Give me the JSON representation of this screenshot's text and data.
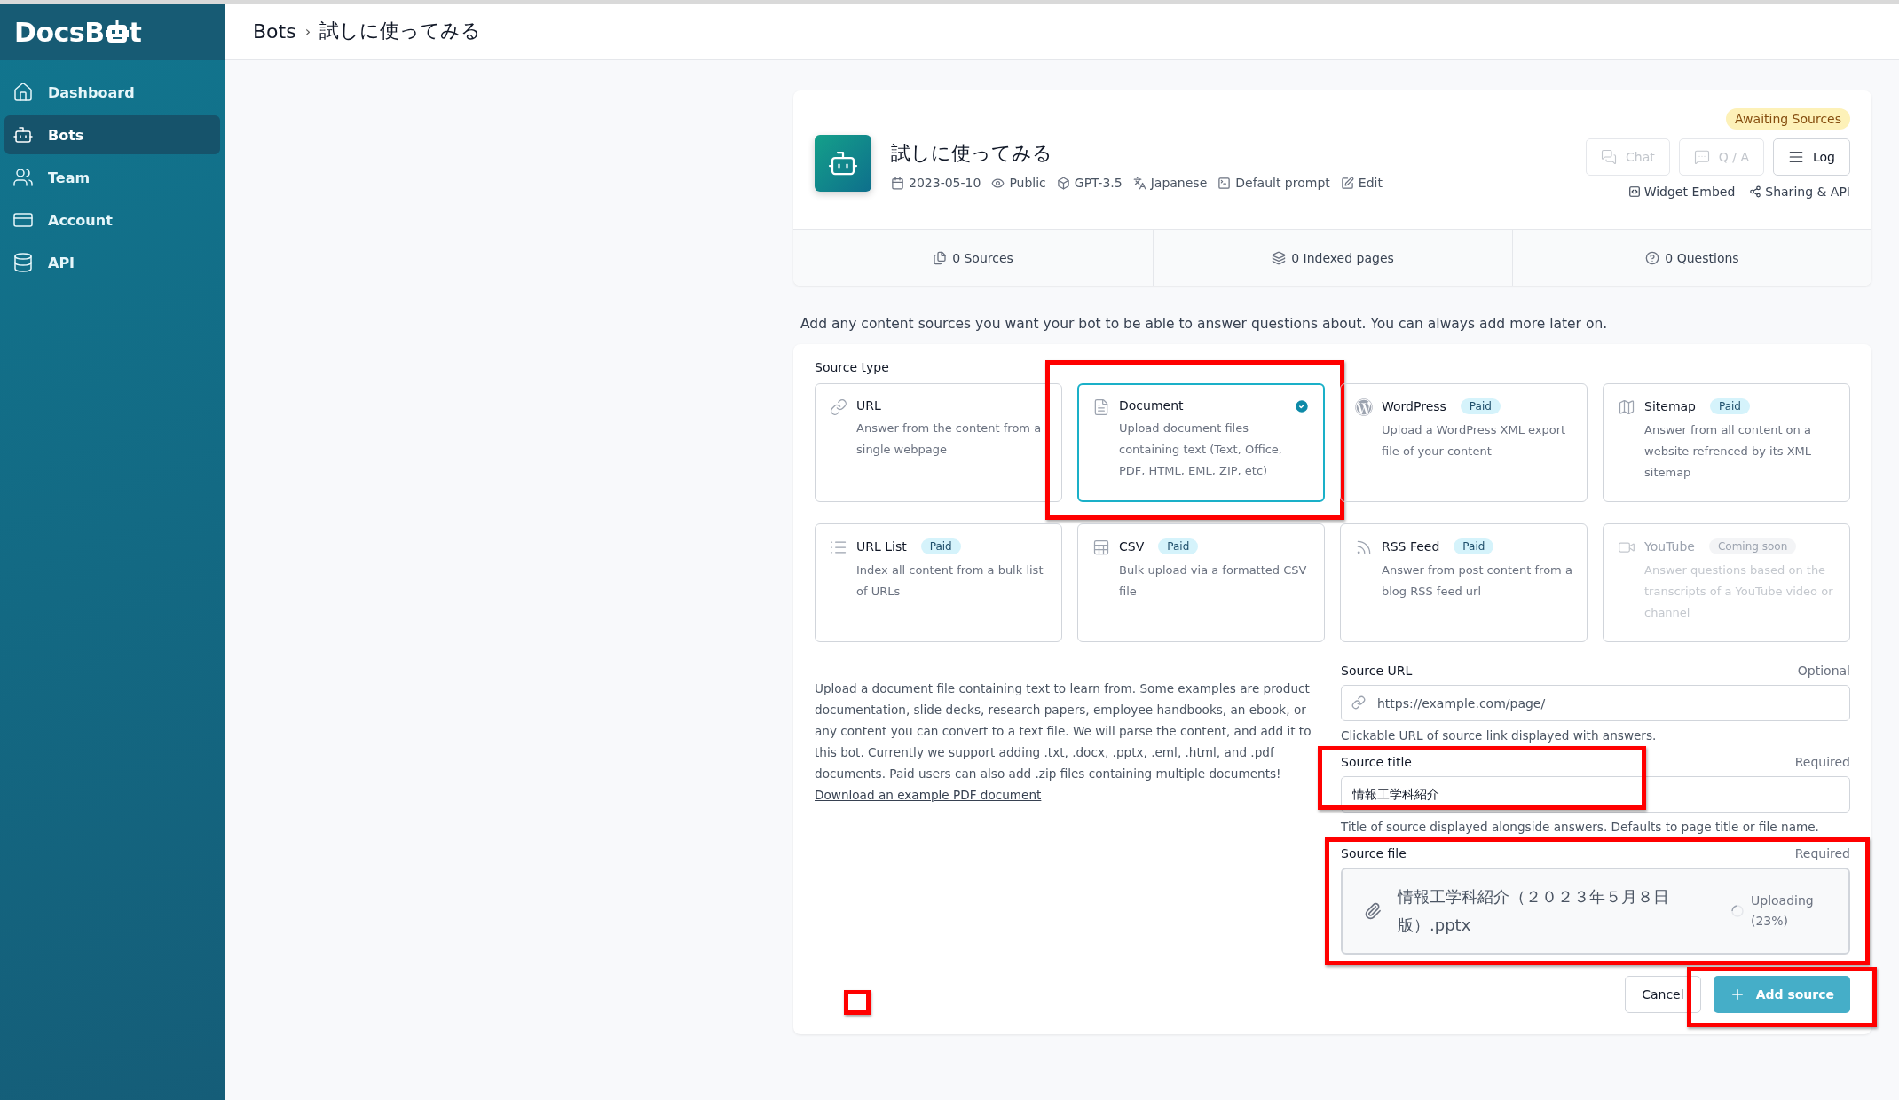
{
  "sidebar": {
    "logo": {
      "before": "DocsB",
      "after": "t"
    },
    "items": [
      {
        "label": "Dashboard",
        "selected": false
      },
      {
        "label": "Bots",
        "selected": true
      },
      {
        "label": "Team",
        "selected": false
      },
      {
        "label": "Account",
        "selected": false
      },
      {
        "label": "API",
        "selected": false
      }
    ]
  },
  "breadcrumb": [
    "Bots",
    "試しに使ってみる"
  ],
  "breadcrumb_separator": "›",
  "bot": {
    "name": "試しに使ってみる",
    "status": "Awaiting Sources",
    "meta": [
      "2023-05-10",
      "Public",
      "GPT-3.5",
      "Japanese",
      "Default prompt",
      "Edit"
    ],
    "actions": [
      {
        "label": "Chat",
        "disabled": true
      },
      {
        "label": "Q / A",
        "disabled": true
      },
      {
        "label": "Log",
        "disabled": false
      }
    ],
    "links": [
      "Widget Embed",
      "Sharing & API"
    ],
    "stats": [
      "0 Sources",
      "0 Indexed pages",
      "0 Questions"
    ]
  },
  "intro": "Add any content sources you want your bot to be able to answer questions about. You can always add more later on.",
  "form": {
    "source_type_label": "Source type",
    "source_types": [
      {
        "title": "URL",
        "description": "Answer from the content from a single webpage",
        "selected": false,
        "disabled": false,
        "highlighted": false
      },
      {
        "title": "Document",
        "description": "Upload document files containing text (Text, Office, PDF, HTML, EML, ZIP, etc)",
        "selected": true,
        "disabled": false,
        "highlighted": true
      },
      {
        "title": "WordPress",
        "badge": "Paid",
        "description": "Upload a WordPress XML export file of your content",
        "selected": false,
        "disabled": false,
        "highlighted": false
      },
      {
        "title": "Sitemap",
        "badge": "Paid",
        "description": "Answer from all content on a website refrenced by its XML sitemap",
        "selected": false,
        "disabled": false,
        "highlighted": false
      },
      {
        "title": "URL List",
        "badge": "Paid",
        "description": "Index all content from a bulk list of URLs",
        "selected": false,
        "disabled": false,
        "highlighted": false
      },
      {
        "title": "CSV",
        "badge": "Paid",
        "description": "Bulk upload via a formatted CSV file",
        "selected": false,
        "disabled": false,
        "highlighted": false
      },
      {
        "title": "RSS Feed",
        "badge": "Paid",
        "description": "Answer from post content from a blog RSS feed url",
        "selected": false,
        "disabled": false,
        "highlighted": false
      },
      {
        "title": "YouTube",
        "badge": "Coming soon",
        "description": "Answer questions based on the transcripts of a YouTube video or channel",
        "selected": false,
        "disabled": true,
        "highlighted": false
      }
    ],
    "help_text": "Upload a document file containing text to learn from. Some examples are product documentation, slide decks, research papers, employee handbooks, an ebook, or any content you can convert to a text file. We will parse the content, and add it to this bot. Currently we support adding .txt, .docx, .pptx, .eml, .html, and .pdf documents. Paid users can also add .zip files containing multiple documents!",
    "help_link": "Download an example PDF document",
    "fields": [
      {
        "kind": "text",
        "label": "Source URL",
        "note": "Optional",
        "placeholder": "https://example.com/page/",
        "hint": "Clickable URL of source link displayed with answers.",
        "highlighted": false
      },
      {
        "kind": "text",
        "label": "Source title",
        "note": "Required",
        "value": "情報工学科紹介",
        "hint": "Title of source displayed alongside answers. Defaults to page title or file name.",
        "highlighted": true
      },
      {
        "kind": "file",
        "label": "Source file",
        "note": "Required",
        "file_name": "情報工学科紹介（２０２３年５月８日版）.pptx",
        "status": "Uploading (23%)",
        "highlighted": true
      }
    ],
    "buttons": [
      {
        "label": "Cancel",
        "kind": "secondary",
        "highlighted": false
      },
      {
        "label": "Add source",
        "kind": "primary",
        "highlighted": true
      }
    ],
    "annotation_marker": true
  }
}
